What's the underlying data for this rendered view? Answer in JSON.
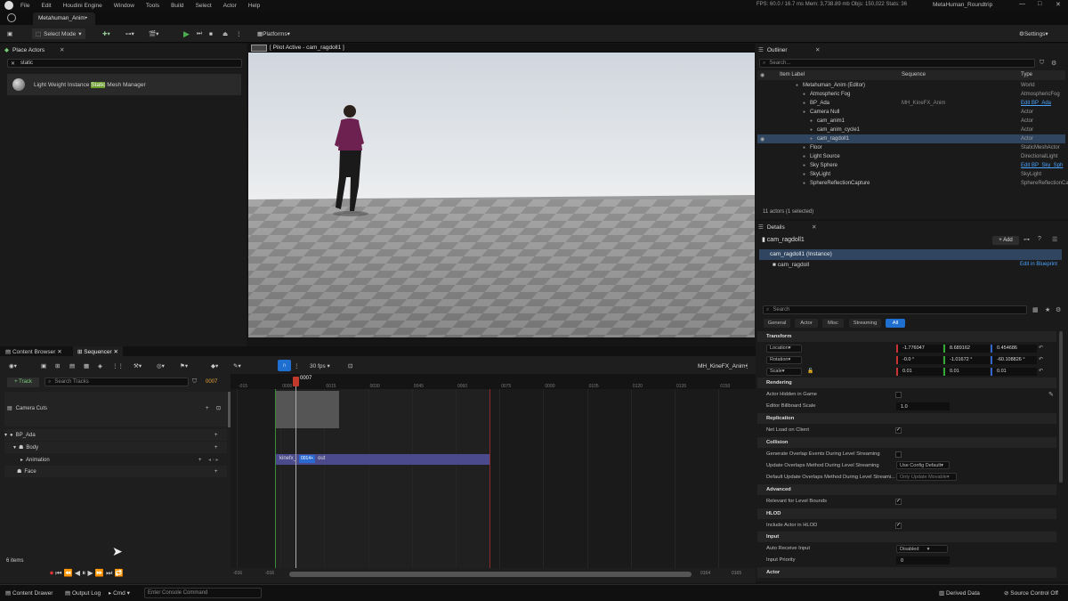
{
  "menu": {
    "items": [
      "File",
      "Edit",
      "Houdini Engine",
      "Window",
      "Tools",
      "Build",
      "Select",
      "Actor",
      "Help"
    ],
    "stats": "FPS: 60.0  /  16.7 ms   Mem: 3,738.89 mb   Objs: 150,022   Stats: 36",
    "project": "MetaHuman_Roundtrip"
  },
  "tab": {
    "label": "Metahuman_Anim•"
  },
  "toolbar": {
    "select_mode": "Select Mode",
    "platforms": "Platforms",
    "settings": "Settings"
  },
  "place_actors": {
    "title": "Place Actors",
    "search_value": "static",
    "result_prefix": "Light Weight Instance ",
    "result_highlight": "Static",
    "result_suffix": " Mesh Manager"
  },
  "viewport": {
    "pilot_label": "[ Pilot Active - cam_ragdoll1 ]"
  },
  "outliner": {
    "title": "Outliner",
    "search_placeholder": "Search...",
    "col_label": "Item Label",
    "col_sequence": "Sequence",
    "col_type": "Type",
    "rows": [
      {
        "label": "Metahuman_Anim (Editor)",
        "sequence": "",
        "type": "World"
      },
      {
        "label": "Atmospheric Fog",
        "sequence": "",
        "type": "AtmosphericFog"
      },
      {
        "label": "BP_Ada",
        "sequence": "MH_KineFX_Anim",
        "type": "Edit BP_Ada"
      },
      {
        "label": "Camera Null",
        "sequence": "",
        "type": "Actor"
      },
      {
        "label": "cam_anim1",
        "sequence": "",
        "type": "Actor"
      },
      {
        "label": "cam_anim_cycle1",
        "sequence": "",
        "type": "Actor"
      },
      {
        "label": "cam_ragdoll1",
        "sequence": "",
        "type": "Actor"
      },
      {
        "label": "Floor",
        "sequence": "",
        "type": "StaticMeshActor"
      },
      {
        "label": "Light Source",
        "sequence": "",
        "type": "DirectionalLight"
      },
      {
        "label": "Sky Sphere",
        "sequence": "",
        "type": "Edit BP_Sky_Sph"
      },
      {
        "label": "SkyLight",
        "sequence": "",
        "type": "SkyLight"
      },
      {
        "label": "SphereReflectionCapture",
        "sequence": "",
        "type": "SphereReflectionCapture"
      }
    ],
    "footer": "11 actors (1 selected)"
  },
  "details": {
    "title": "Details",
    "object_name": "cam_ragdoll1",
    "add_label": "+ Add",
    "instance_label": "cam_ragdoll1 (Instance)",
    "component": "cam_ragdoll",
    "edit_bp": "Edit in Blueprint",
    "search_placeholder": "Search",
    "filter_tabs": [
      "General",
      "Actor",
      "Misc",
      "Streaming",
      "All"
    ],
    "sections": {
      "transform": "Transform",
      "rendering": "Rendering",
      "replication": "Replication",
      "collision": "Collision",
      "advanced": "Advanced",
      "hlod": "HLOD",
      "input": "Input",
      "actor": "Actor"
    },
    "location": {
      "label": "Location",
      "x": "-1.776047",
      "y": "8.689162",
      "z": "0.454686"
    },
    "rotation": {
      "label": "Rotation",
      "x": "-0.0 °",
      "y": "-1.01672 °",
      "z": "-60.108826 °"
    },
    "scale": {
      "label": "Scale",
      "x": "0.01",
      "y": "0.01",
      "z": "0.01"
    },
    "props": {
      "actor_hidden": "Actor Hidden in Game",
      "billboard_scale": "Editor Billboard Scale",
      "billboard_value": "1.0",
      "net_load": "Net Load on Client",
      "gen_overlap": "Generate Overlap Events During Level Streaming",
      "upd_overlap": "Update Overlaps Method During Level Streaming",
      "upd_overlap_value": "Use Config Default",
      "def_upd_overlap": "Default Update Overlaps Method During Level Streami...",
      "def_upd_value": "Only Update Movable",
      "relevant_bounds": "Relevant for Level Bounds",
      "include_hlod": "Include Actor in HLOD",
      "auto_input": "Auto Receive Input",
      "auto_input_value": "Disabled",
      "input_priority": "Input Priority",
      "input_priority_value": "0"
    }
  },
  "bottom_tabs": {
    "content_browser": "Content Browser",
    "sequencer": "Sequencer"
  },
  "sequencer": {
    "fps": "30 fps",
    "sequence_name": "MH_KineFX_Anim•",
    "add_track": "+ Track",
    "search_placeholder": "Search Tracks",
    "frame": "0007",
    "playhead": "0007",
    "tracks": {
      "camera_cuts": "Camera Cuts",
      "bp": "BP_Ada",
      "body": "Body",
      "animation": "Animation",
      "face": "Face"
    },
    "ruler": [
      "-015",
      "0000",
      "0015",
      "0030",
      "0045",
      "0060",
      "0075",
      "0090",
      "0105",
      "0120",
      "0135",
      "0150"
    ],
    "clip_label": "kinefx_",
    "clip_suffix": "out",
    "clip_marker": "0014+",
    "items_count": "6 items",
    "range_start": "-016",
    "range_start2": "-016",
    "range_end": "0164",
    "range_end2": "0165"
  },
  "status": {
    "content_drawer": "Content Drawer",
    "output_log": "Output Log",
    "cmd": "Cmd",
    "console_placeholder": "Enter Console Command",
    "derived": "Derived Data",
    "source_control": "Source Control Off"
  }
}
